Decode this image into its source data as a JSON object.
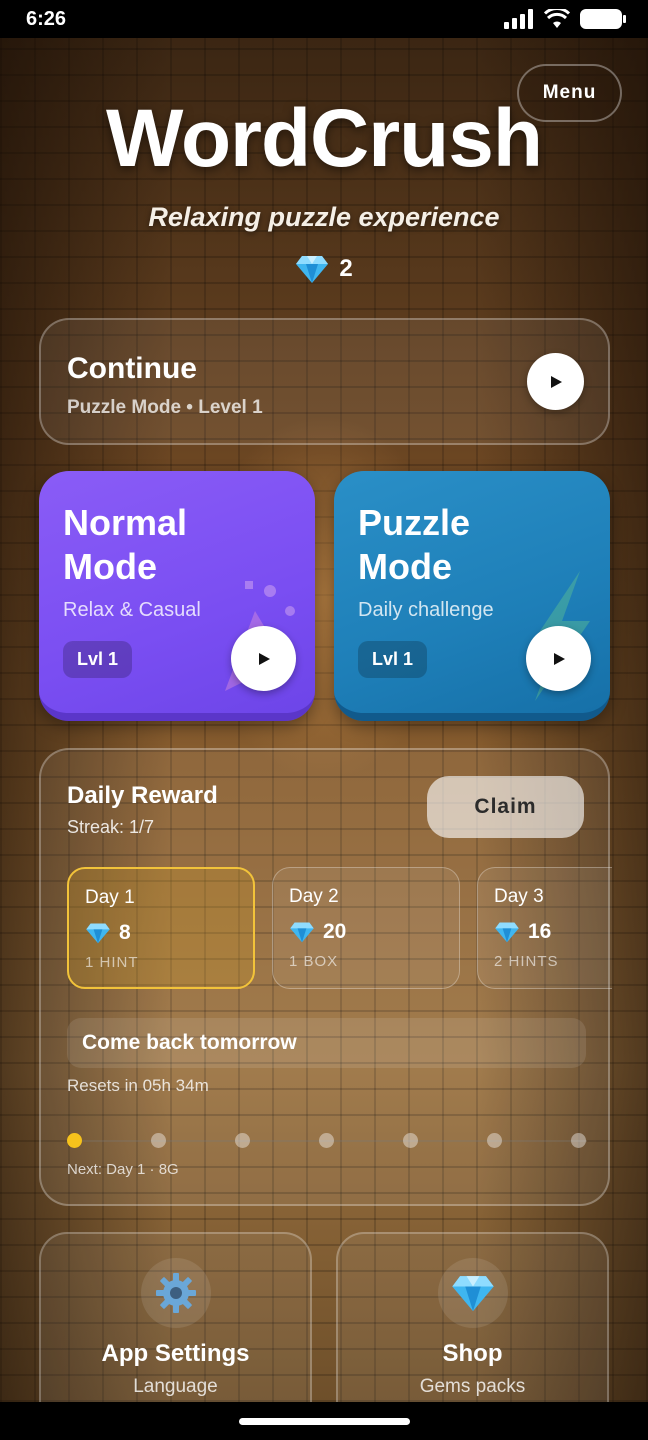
{
  "status_bar": {
    "time": "6:26"
  },
  "header": {
    "menu_label": "Menu",
    "title": "WordCrush",
    "subtitle": "Relaxing puzzle experience",
    "gem_count": "2"
  },
  "continue": {
    "title": "Continue",
    "subtitle": "Puzzle Mode • Level 1"
  },
  "modes": [
    {
      "title_line1": "Normal",
      "title_line2": "Mode",
      "subtitle": "Relax & Casual",
      "level": "Lvl 1",
      "color": "#7a4ef2"
    },
    {
      "title_line1": "Puzzle",
      "title_line2": "Mode",
      "subtitle": "Daily challenge",
      "level": "Lvl 1",
      "color": "#1e7fb8"
    }
  ],
  "daily_reward": {
    "title": "Daily Reward",
    "streak": "Streak: 1/7",
    "claim_label": "Claim",
    "days": [
      {
        "label": "Day 1",
        "gems": "8",
        "gift": "1 HINT",
        "active": true
      },
      {
        "label": "Day 2",
        "gems": "20",
        "gift": "1 BOX",
        "active": false
      },
      {
        "label": "Day 3",
        "gems": "16",
        "gift": "2 HINTS",
        "active": false
      }
    ],
    "come_back": "Come back tomorrow",
    "resets": "Resets in 05h 34m",
    "streak_progress": {
      "filled": 1,
      "total": 7
    },
    "next": "Next: Day 1 · 8G",
    "accent_color": "#f6c21c"
  },
  "tiles": {
    "settings": {
      "title": "App Settings",
      "subtitle": "Language",
      "icon": "gear-icon"
    },
    "shop": {
      "title": "Shop",
      "subtitle": "Gems packs",
      "icon": "gem-icon"
    }
  }
}
